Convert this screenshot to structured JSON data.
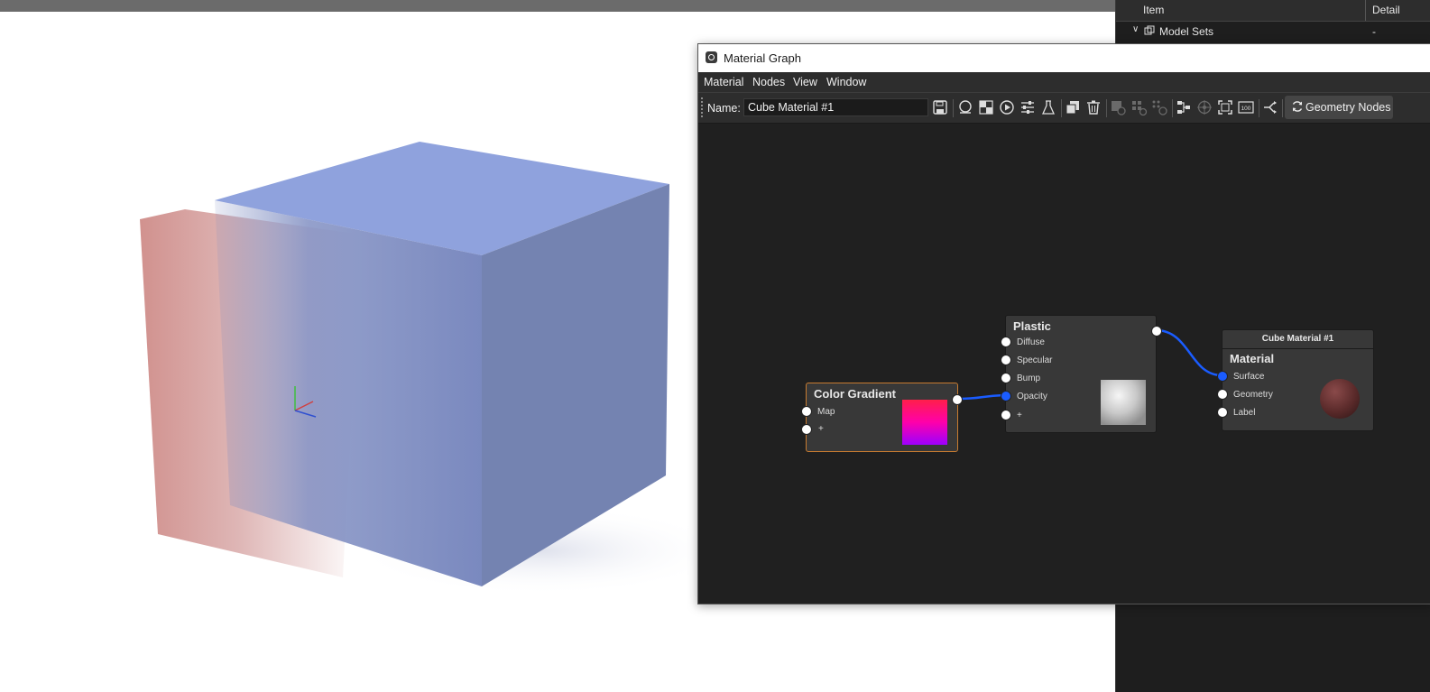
{
  "viewport": {
    "cube_colors": {
      "top": "#8fa2dd",
      "right": "#7483b1",
      "front": "#7a89bf",
      "panel": "#c97e7a"
    }
  },
  "tree_panel": {
    "header": {
      "item": "Item",
      "detail": "Detail"
    },
    "rows": [
      {
        "label": "Model Sets",
        "detail": "-"
      }
    ]
  },
  "material_graph": {
    "title": "Material Graph",
    "menu": [
      "Material",
      "Nodes",
      "View",
      "Window"
    ],
    "toolbar": {
      "name_label": "Name:",
      "name_value": "Cube Material #1",
      "geometry_nodes_label": "Geometry Nodes",
      "icons": [
        "save-icon",
        "sphere-preview-icon",
        "checker-icon",
        "play-icon",
        "sliders-icon",
        "flask-icon",
        "duplicate-icon",
        "trash-icon",
        "disabled-add-icon",
        "disabled-grid-icon",
        "disabled-dots-icon",
        "tree-layout-icon",
        "disabled-orbit-icon",
        "fit-icon",
        "zoom-100-icon",
        "split-icon"
      ]
    },
    "nodes": {
      "color_gradient": {
        "title": "Color Gradient",
        "ports": [
          "Map",
          "+"
        ],
        "gradient_colors": [
          "#ff1f4a",
          "#ff00aa",
          "#9d00ff"
        ]
      },
      "plastic": {
        "title": "Plastic",
        "ports": [
          "Diffuse",
          "Specular",
          "Bump",
          "Opacity",
          "+"
        ]
      },
      "material": {
        "header": "Cube Material #1",
        "title": "Material",
        "ports": [
          "Surface",
          "Geometry",
          "Label"
        ]
      }
    },
    "wire_color": "#1a5cff"
  }
}
